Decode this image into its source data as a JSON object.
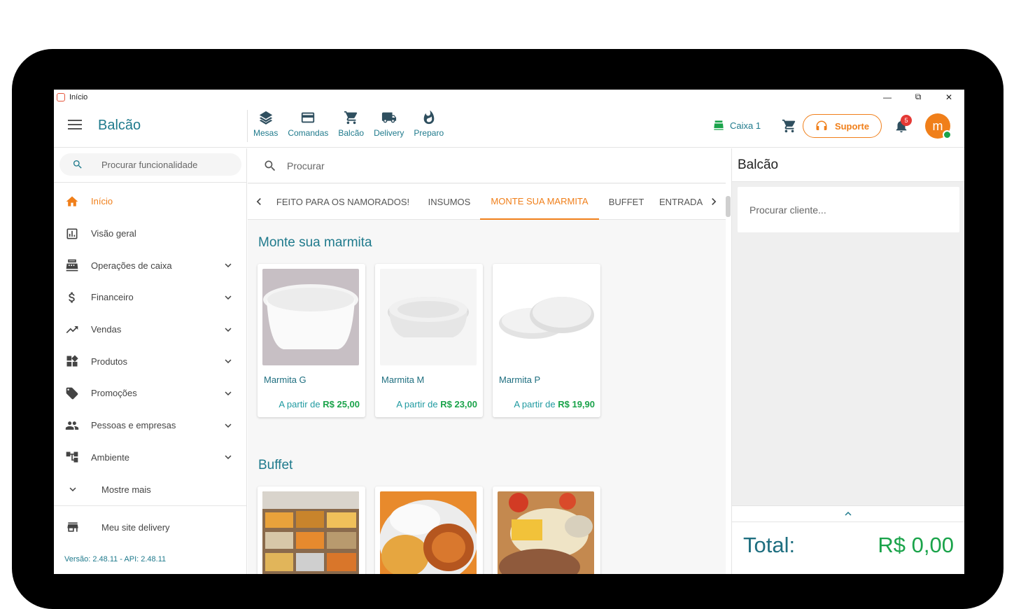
{
  "window": {
    "title": "Início"
  },
  "header": {
    "title": "Balcão",
    "nav": [
      {
        "label": "Mesas",
        "icon": "layers-icon"
      },
      {
        "label": "Comandas",
        "icon": "card-icon"
      },
      {
        "label": "Balcão",
        "icon": "cart-icon"
      },
      {
        "label": "Delivery",
        "icon": "truck-icon"
      },
      {
        "label": "Preparo",
        "icon": "flame-icon"
      }
    ],
    "caixa": "Caixa 1",
    "suporte": "Suporte",
    "notifications": "5",
    "avatar": "m"
  },
  "sidebar": {
    "search_placeholder": "Procurar funcionalidade",
    "items": [
      {
        "label": "Início",
        "icon": "home-icon",
        "active": true
      },
      {
        "label": "Visão geral",
        "icon": "chart-icon"
      },
      {
        "label": "Operações de caixa",
        "icon": "register-icon",
        "expand": true
      },
      {
        "label": "Financeiro",
        "icon": "dollar-icon",
        "expand": true
      },
      {
        "label": "Vendas",
        "icon": "trend-icon",
        "expand": true
      },
      {
        "label": "Produtos",
        "icon": "widgets-icon",
        "expand": true
      },
      {
        "label": "Promoções",
        "icon": "tag-icon",
        "expand": true
      },
      {
        "label": "Pessoas e empresas",
        "icon": "people-icon",
        "expand": true
      },
      {
        "label": "Ambiente",
        "icon": "tree-icon",
        "expand": true
      },
      {
        "label": "Mostre mais",
        "icon": "chevron-down-icon"
      }
    ],
    "site_delivery": "Meu site delivery",
    "version": "Versão: 2.48.11 - API: 2.48.11"
  },
  "main": {
    "search_placeholder": "Procurar",
    "tabs": [
      "FEITO PARA OS NAMORADOS!",
      "INSUMOS",
      "MONTE SUA MARMITA",
      "BUFFET",
      "ENTRADA"
    ],
    "active_tab": 2,
    "sections": [
      {
        "title": "Monte sua marmita",
        "products": [
          {
            "name": "Marmita G",
            "price_prefix": "A partir de",
            "price": "R$ 25,00"
          },
          {
            "name": "Marmita M",
            "price_prefix": "A partir de",
            "price": "R$ 23,00"
          },
          {
            "name": "Marmita P",
            "price_prefix": "A partir de",
            "price": "R$ 19,90"
          }
        ]
      },
      {
        "title": "Buffet"
      }
    ]
  },
  "rightpanel": {
    "title": "Balcão",
    "client_placeholder": "Procurar cliente...",
    "total_label": "Total:",
    "total_value": "R$ 0,00"
  },
  "colors": {
    "accent": "#f07f1a",
    "teal": "#1f7a8c",
    "green": "#1aa34a"
  }
}
